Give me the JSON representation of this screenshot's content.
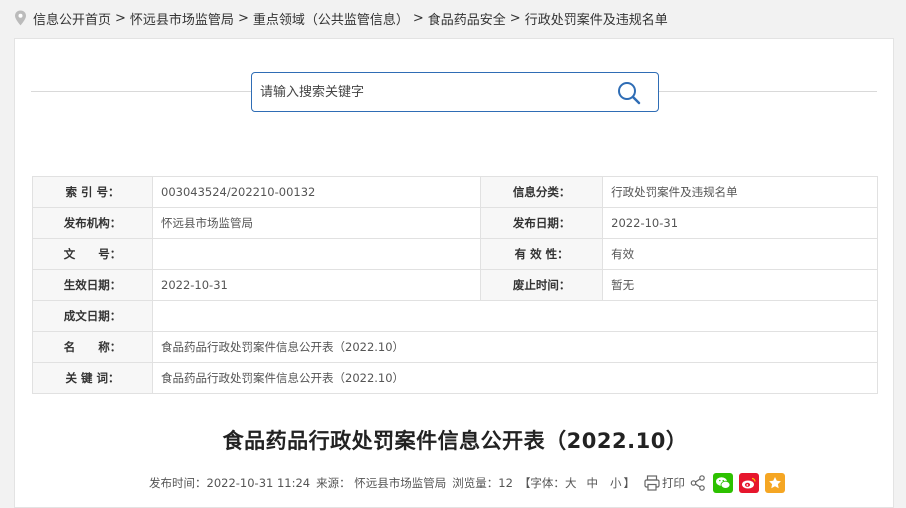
{
  "breadcrumb": [
    "信息公开首页",
    "怀远县市场监管局",
    "重点领域（公共监管信息）",
    "食品药品安全",
    "行政处罚案件及违规名单"
  ],
  "search": {
    "placeholder": "请输入搜索关键字"
  },
  "meta": {
    "index_label": "索 引 号：",
    "index_value": "003043524/202210-00132",
    "category_label": "信息分类：",
    "category_value": "行政处罚案件及违规名单",
    "publisher_label": "发布机构：",
    "publisher_value": "怀远县市场监管局",
    "pubdate_label": "发布日期：",
    "pubdate_value": "2022-10-31",
    "docno_label": "文　　号：",
    "docno_value": "",
    "validity_label": "有 效 性：",
    "validity_value": "有效",
    "effective_label": "生效日期：",
    "effective_value": "2022-10-31",
    "repeal_label": "废止时间：",
    "repeal_value": "暂无",
    "written_label": "成文日期：",
    "written_value": "",
    "name_label": "名　　称：",
    "name_value": "食品药品行政处罚案件信息公开表（2022.10）",
    "keywords_label": "关 键 词：",
    "keywords_value": "食品药品行政处罚案件信息公开表（2022.10）"
  },
  "article": {
    "title": "食品药品行政处罚案件信息公开表（2022.10）",
    "pubtime": "发布时间：2022-10-31 11:24",
    "source": "来源： 怀远县市场监管局",
    "views": "浏览量：12",
    "font_prefix": "【字体：",
    "font_large": "大",
    "font_medium": "中",
    "font_small": "小",
    "font_suffix": "】",
    "print": "打印"
  },
  "colors": {
    "accent": "#2f6db5",
    "wechat": "#2dc100",
    "weibo": "#e6162d",
    "favorite": "#f5a623"
  },
  "icons": [
    "location-pin-icon",
    "search-icon",
    "print-icon",
    "share-icon",
    "wechat-icon",
    "weibo-icon",
    "star-icon"
  ]
}
